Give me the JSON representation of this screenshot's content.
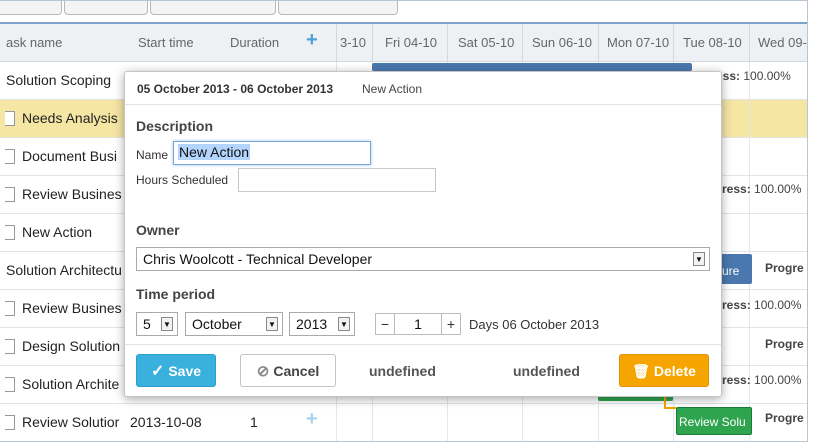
{
  "grid": {
    "columns": {
      "task_name": "ask name",
      "start_time": "Start time",
      "duration": "Duration"
    },
    "add_icon": "+",
    "rows": [
      {
        "name": "Solution Scoping",
        "level": "top"
      },
      {
        "name": "Needs Analysis",
        "level": "child",
        "highlighted": true
      },
      {
        "name": "Document Busi",
        "level": "child"
      },
      {
        "name": "Review Busines",
        "level": "child"
      },
      {
        "name": "New Action",
        "level": "child"
      },
      {
        "name": "Solution Architectu",
        "level": "top"
      },
      {
        "name": "Review Busines",
        "level": "child"
      },
      {
        "name": "Design Solution",
        "level": "child"
      },
      {
        "name": "Solution Archite",
        "level": "child"
      },
      {
        "name": "Review Solutior",
        "level": "child",
        "start": "2013-10-08",
        "duration": "1"
      }
    ]
  },
  "timeline": {
    "dates": [
      "3-10",
      "Fri 04-10",
      "Sat 05-10",
      "Sun 06-10",
      "Mon 07-10",
      "Tue 08-10",
      "Wed 09-"
    ],
    "progress_labels": [
      {
        "text_bold": "ress:",
        "text": " 100.00%"
      },
      {
        "text_bold": "ress:",
        "text": " 100.00%"
      },
      {
        "text_bold": "ress:",
        "text": " 100.00%"
      },
      {
        "text_bold": "ress:",
        "text": " 100.00%"
      }
    ],
    "top_progress": {
      "text_bold": "Progress:",
      "text": " 100.00%"
    },
    "progre_label": "Progre",
    "progre_label2": "Progre",
    "progre_label3": "Progre",
    "bar_ure": "ure",
    "bar_review": "Review Solu"
  },
  "modal": {
    "date_range": "05 October 2013 - 06 October 2013",
    "action_title": "New Action",
    "description_heading": "Description",
    "name_label": "Name",
    "name_value": "New Action",
    "hours_label": "Hours Scheduled",
    "hours_value": "",
    "owner_heading": "Owner",
    "owner_value": "Chris Woolcott - Technical Developer",
    "time_heading": "Time period",
    "day_value": "5",
    "month_value": "October",
    "year_value": "2013",
    "duration_minus": "−",
    "duration_value": "1",
    "duration_plus": "+",
    "duration_text": "Days 06 October 2013",
    "save_label": "Save",
    "cancel_label": "Cancel",
    "undefined_1": "undefined",
    "undefined_2": "undefined",
    "delete_label": "Delete"
  },
  "colors": {
    "save": "#3ab0de",
    "delete": "#f5a400",
    "highlight_row": "#f5e6a4",
    "gantt_green": "#2ea44f",
    "gantt_blue": "#4a78ae"
  }
}
